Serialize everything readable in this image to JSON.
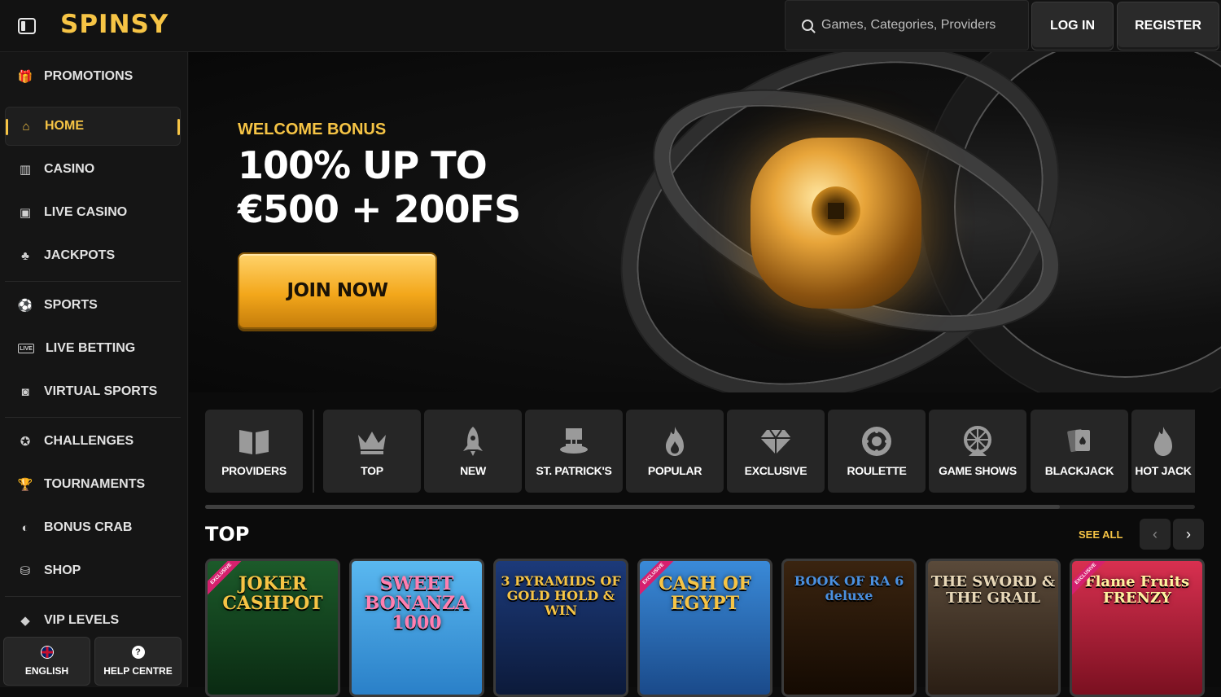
{
  "header": {
    "logo": "SPINSY",
    "search_placeholder": "Games, Categories, Providers",
    "login_label": "LOG IN",
    "register_label": "REGISTER"
  },
  "sidebar": {
    "items": [
      {
        "label": "PROMOTIONS",
        "icon": "gift-icon"
      },
      {
        "label": "HOME",
        "icon": "home-icon",
        "active": true
      },
      {
        "label": "CASINO",
        "icon": "slot-machine-icon"
      },
      {
        "label": "LIVE CASINO",
        "icon": "live-casino-icon"
      },
      {
        "label": "JACKPOTS",
        "icon": "clover-icon"
      },
      {
        "label": "SPORTS",
        "icon": "ball-icon"
      },
      {
        "label": "LIVE BETTING",
        "icon": "live-badge-icon"
      },
      {
        "label": "VIRTUAL SPORTS",
        "icon": "virtual-sports-icon"
      },
      {
        "label": "CHALLENGES",
        "icon": "challenges-icon"
      },
      {
        "label": "TOURNAMENTS",
        "icon": "trophy-icon"
      },
      {
        "label": "BONUS CRAB",
        "icon": "crab-icon"
      },
      {
        "label": "SHOP",
        "icon": "shop-icon"
      },
      {
        "label": "VIP LEVELS",
        "icon": "diamond-icon"
      }
    ],
    "language_label": "ENGLISH",
    "help_label": "HELP CENTRE"
  },
  "hero": {
    "subtitle": "WELCOME BONUS",
    "title_line1": "100% UP TO",
    "title_line2": "€500 + 200FS",
    "cta_label": "JOIN NOW"
  },
  "categories": [
    {
      "label": "PROVIDERS",
      "icon": "book-icon"
    },
    {
      "label": "TOP",
      "icon": "crown-icon"
    },
    {
      "label": "NEW",
      "icon": "rocket-icon"
    },
    {
      "label": "ST. PATRICK'S",
      "icon": "leprechaun-hat-icon"
    },
    {
      "label": "POPULAR",
      "icon": "flame-icon"
    },
    {
      "label": "EXCLUSIVE",
      "icon": "diamond-icon"
    },
    {
      "label": "ROULETTE",
      "icon": "roulette-icon"
    },
    {
      "label": "GAME SHOWS",
      "icon": "wheel-icon"
    },
    {
      "label": "BLACKJACK",
      "icon": "cards-icon"
    },
    {
      "label": "HOT JACK",
      "icon": "hot-flame-icon"
    }
  ],
  "top_section": {
    "title": "TOP",
    "see_all_label": "SEE ALL",
    "games": [
      {
        "name": "JOKER CASHPOT",
        "exclusive": true,
        "exclusive_label": "EXCLUSIVE",
        "bg": "#1c5a2a"
      },
      {
        "name": "SWEET BONANZA 1000",
        "exclusive": false,
        "bg": "#3fa0e0"
      },
      {
        "name": "3 PYRAMIDS OF GOLD HOLD & WIN",
        "exclusive": false,
        "bg": "#1c3a7a"
      },
      {
        "name": "CASH OF EGYPT",
        "exclusive": true,
        "exclusive_label": "EXCLUSIVE",
        "bg": "#2a6db8"
      },
      {
        "name": "BOOK OF RA 6 deluxe",
        "exclusive": false,
        "bg": "#2a1808"
      },
      {
        "name": "THE SWORD & THE GRAIL",
        "exclusive": false,
        "bg": "#4a3a2a"
      },
      {
        "name": "Flame Fruits FRENZY",
        "exclusive": true,
        "exclusive_label": "EXCLUSIVE",
        "bg": "#b0203a"
      }
    ]
  },
  "colors": {
    "accent": "#f6c445",
    "background": "#0d0d0d",
    "panel": "#262626"
  }
}
